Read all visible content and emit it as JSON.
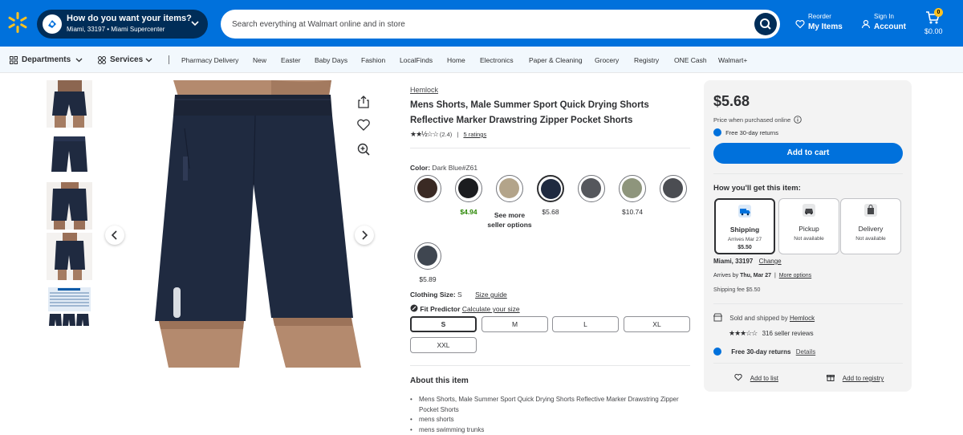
{
  "header": {
    "location_title": "How do you want your items?",
    "location_sub": "Miami, 33197 • Miami Supercenter",
    "search_placeholder": "Search everything at Walmart online and in store",
    "reorder_small": "Reorder",
    "reorder_big": "My Items",
    "signin_small": "Sign In",
    "signin_big": "Account",
    "cart_count": "0",
    "cart_total": "$0.00"
  },
  "nav": {
    "departments": "Departments",
    "services": "Services",
    "links": [
      "Pharmacy Delivery",
      "New",
      "Easter",
      "Baby Days",
      "Fashion",
      "LocalFinds",
      "Home",
      "Electronics",
      "Paper & Cleaning",
      "Grocery",
      "Registry",
      "ONE Cash",
      "Walmart+"
    ]
  },
  "product": {
    "brand": "Hemlock",
    "title": "Mens Shorts, Male Summer Sport Quick Drying Shorts Reflective Marker Drawstring Zipper Pocket Shorts",
    "rating_value": "(2.4)",
    "rating_stars": 2.4,
    "ratings_link": "5 ratings",
    "color_label": "Color:",
    "color_value": "Dark Blue#Z61",
    "swatches": [
      {
        "color": "#3a2a24",
        "price": ""
      },
      {
        "color": "#1b1c1f",
        "price": "$4.94"
      },
      {
        "color": "#b3a48a",
        "price": "See more seller options"
      },
      {
        "color": "#1f2a40",
        "price": "$5.68"
      },
      {
        "color": "#55575c",
        "price": ""
      },
      {
        "color": "#8e957c",
        "price": "$10.74"
      },
      {
        "color": "#4b4d52",
        "price": ""
      },
      {
        "color": "#3f4650",
        "price": "$5.89"
      }
    ],
    "size_label": "Clothing Size:",
    "size_value": "S",
    "size_guide": "Size guide",
    "fit_predictor": "Fit Predictor",
    "fit_link": "Calculate your size",
    "sizes": [
      "S",
      "M",
      "L",
      "XL",
      "XXL"
    ],
    "about_title": "About this item",
    "bullets": [
      "Mens Shorts, Male Summer Sport Quick Drying Shorts Reflective Marker Drawstring Zipper Pocket Shorts",
      "mens shorts",
      "mens swimming trunks"
    ]
  },
  "buybox": {
    "price": "$5.68",
    "price_note": "Price when purchased online",
    "free_returns": "Free 30-day returns",
    "add_to_cart": "Add to cart",
    "how_title": "How you'll get this item:",
    "options": [
      {
        "name": "Shipping",
        "sub": "Arrives Mar 27",
        "price": "$5.50"
      },
      {
        "name": "Pickup",
        "sub": "Not available",
        "price": ""
      },
      {
        "name": "Delivery",
        "sub": "Not available",
        "price": ""
      }
    ],
    "location": "Miami, 33197",
    "change": "Change",
    "arrives_prefix": "Arrives by",
    "arrives_date": "Thu, Mar 27",
    "more_options": "More options",
    "shipping_fee": "Shipping fee $5.50",
    "sold_by_prefix": "Sold and shipped by",
    "seller": "Hemlock",
    "seller_reviews": "316 seller reviews",
    "returns_label": "Free 30-day returns",
    "details": "Details",
    "add_to_list": "Add to list",
    "add_to_registry": "Add to registry"
  },
  "colors": {
    "brand_blue": "#0071dc",
    "dark_blue": "#002d58",
    "yellow": "#ffc220",
    "green_price": "#2a8703"
  }
}
